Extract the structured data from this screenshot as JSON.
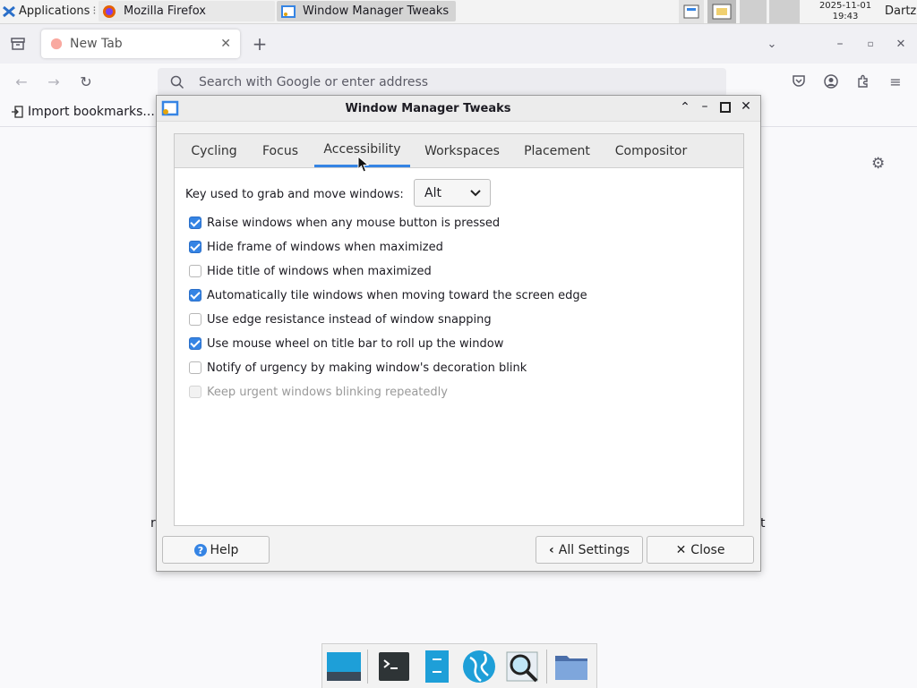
{
  "panel": {
    "applications_label": "Applications",
    "tasks": [
      {
        "label": "Mozilla Firefox",
        "icon": "firefox-icon"
      },
      {
        "label": "Window Manager Tweaks",
        "icon": "wm-tweaks-icon"
      }
    ],
    "clock_date": "2025-11-01",
    "clock_time": "19:43",
    "user": "Dartz"
  },
  "firefox": {
    "tab_title": "New Tab",
    "new_tab_symbol": "+",
    "address_placeholder": "Search with Google or enter address",
    "bookmark_label": "Import bookmarks...",
    "bg_text_left": "r",
    "bg_text_right": "t"
  },
  "dialog": {
    "title": "Window Manager Tweaks",
    "tabs": [
      {
        "label": "Cycling",
        "active": false
      },
      {
        "label": "Focus",
        "active": false
      },
      {
        "label": "Accessibility",
        "active": true
      },
      {
        "label": "Workspaces",
        "active": false
      },
      {
        "label": "Placement",
        "active": false
      },
      {
        "label": "Compositor",
        "active": false
      }
    ],
    "grab_key_label": "Key used to grab and move windows:",
    "grab_key_value": "Alt",
    "options": [
      {
        "label": "Raise windows when any mouse button is pressed",
        "checked": true,
        "enabled": true
      },
      {
        "label": "Hide frame of windows when maximized",
        "checked": true,
        "enabled": true
      },
      {
        "label": "Hide title of windows when maximized",
        "checked": false,
        "enabled": true
      },
      {
        "label": "Automatically tile windows when moving toward the screen edge",
        "checked": true,
        "enabled": true
      },
      {
        "label": "Use edge resistance instead of window snapping",
        "checked": false,
        "enabled": true
      },
      {
        "label": "Use mouse wheel on title bar to roll up the window",
        "checked": true,
        "enabled": true
      },
      {
        "label": "Notify of urgency by making window's decoration blink",
        "checked": false,
        "enabled": true
      },
      {
        "label": "Keep urgent windows blinking repeatedly",
        "checked": false,
        "enabled": false
      }
    ],
    "help_label": "Help",
    "all_settings_label": "All Settings",
    "close_label": "Close"
  },
  "colors": {
    "accent": "#3584e4",
    "panel_bg": "#f3f3f3",
    "dialog_bg": "#f3f3f3"
  },
  "dock": {
    "items": [
      "show-desktop-icon",
      "terminal-icon",
      "file-manager-icon",
      "web-browser-icon",
      "app-finder-icon",
      "folder-icon"
    ]
  }
}
